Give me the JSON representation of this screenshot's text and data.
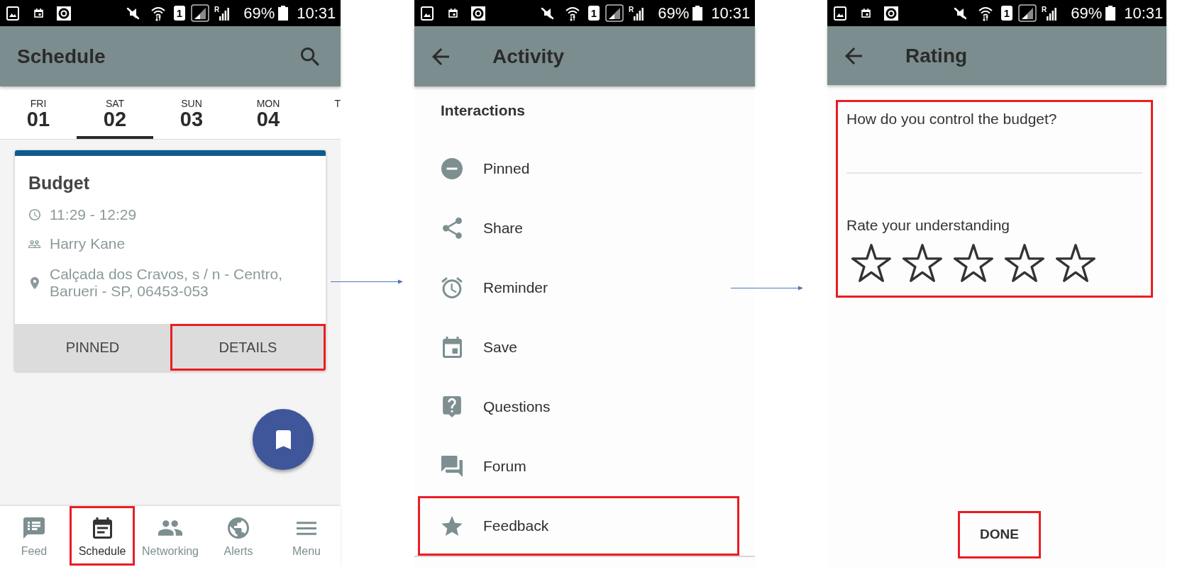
{
  "schedule_screen": {
    "status_bar": {
      "sim": "1",
      "network": "R",
      "battery": "69%",
      "time": "10:31"
    },
    "app_bar": {
      "title": "Schedule"
    },
    "day_tabs": [
      {
        "day": "FRI",
        "date": "01",
        "selected": false
      },
      {
        "day": "SAT",
        "date": "02",
        "selected": true
      },
      {
        "day": "SUN",
        "date": "03",
        "selected": false
      },
      {
        "day": "MON",
        "date": "04",
        "selected": false
      },
      {
        "day": "T",
        "selected": false
      }
    ],
    "event_card": {
      "title": "Budget",
      "details": [
        {
          "kind": "time",
          "text": "11:29 - 12:29"
        },
        {
          "kind": "person",
          "text": "Harry Kane"
        },
        {
          "kind": "location",
          "text": "Calçada dos Cravos, s / n - Centro, Barueri - SP, 06453-053"
        }
      ],
      "buttons": [
        {
          "label": "PINNED",
          "highlighted": false
        },
        {
          "label": "DETAILS",
          "highlighted": true
        }
      ]
    },
    "bottom_nav": [
      {
        "label": "Feed",
        "selected": false,
        "highlighted": false
      },
      {
        "label": "Schedule",
        "selected": true,
        "highlighted": true
      },
      {
        "label": "Networking",
        "selected": false,
        "highlighted": false
      },
      {
        "label": "Alerts",
        "selected": false,
        "highlighted": false
      },
      {
        "label": "Menu",
        "selected": false,
        "highlighted": false
      }
    ]
  },
  "activity_screen": {
    "status_bar": {
      "sim": "1",
      "network": "R",
      "battery": "69%",
      "time": "10:31"
    },
    "app_bar": {
      "title": "Activity"
    },
    "section_title": "Interactions",
    "items": [
      {
        "label": "Pinned",
        "highlighted": false
      },
      {
        "label": "Share",
        "highlighted": false
      },
      {
        "label": "Reminder",
        "highlighted": false
      },
      {
        "label": "Save",
        "highlighted": false
      },
      {
        "label": "Questions",
        "highlighted": false
      },
      {
        "label": "Forum",
        "highlighted": false
      },
      {
        "label": "Feedback",
        "highlighted": true
      }
    ]
  },
  "rating_screen": {
    "status_bar": {
      "sim": "1",
      "network": "R",
      "battery": "69%",
      "time": "10:31"
    },
    "app_bar": {
      "title": "Rating"
    },
    "form": {
      "highlighted": true,
      "question": {
        "label": "How do you control the budget?"
      },
      "rating": {
        "label": "Rate your understanding",
        "stars": 0
      }
    },
    "done_button": {
      "label": "DONE",
      "highlighted": true
    }
  }
}
